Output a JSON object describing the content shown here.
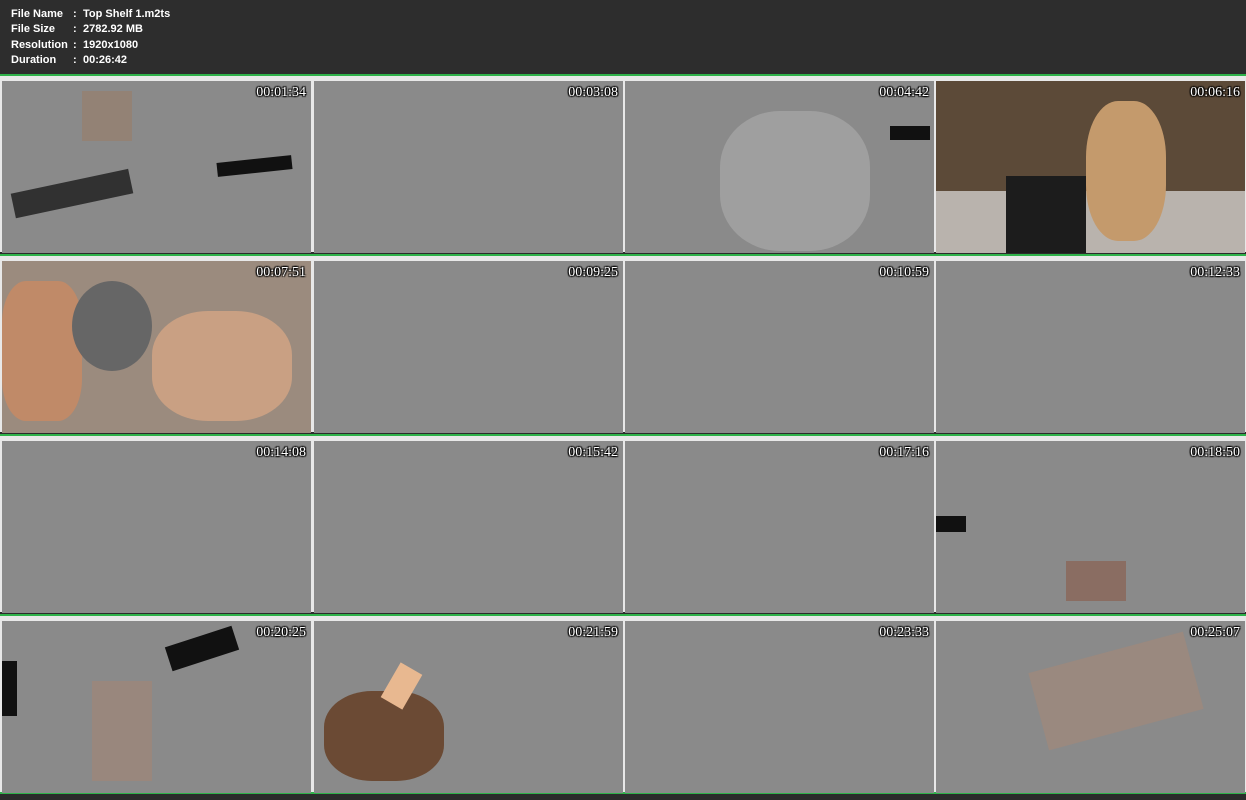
{
  "file_info": {
    "rows": [
      {
        "label": "File Name",
        "sep": ":",
        "value": "Top Shelf 1.m2ts"
      },
      {
        "label": "File Size",
        "sep": ":",
        "value": "2782.92 MB"
      },
      {
        "label": "Resolution",
        "sep": ":",
        "value": "1920x1080"
      },
      {
        "label": "Duration",
        "sep": ":",
        "value": "00:26:42"
      }
    ]
  },
  "thumbnails": [
    {
      "time": "00:01:34"
    },
    {
      "time": "00:03:08"
    },
    {
      "time": "00:04:42"
    },
    {
      "time": "00:06:16"
    },
    {
      "time": "00:07:51"
    },
    {
      "time": "00:09:25"
    },
    {
      "time": "00:10:59"
    },
    {
      "time": "00:12:33"
    },
    {
      "time": "00:14:08"
    },
    {
      "time": "00:15:42"
    },
    {
      "time": "00:17:16"
    },
    {
      "time": "00:18:50"
    },
    {
      "time": "00:20:25"
    },
    {
      "time": "00:21:59"
    },
    {
      "time": "00:23:33"
    },
    {
      "time": "00:25:07"
    }
  ],
  "colors": {
    "accent_border": "#2fb24a",
    "header_bg": "#2d2d2d",
    "thumb_gray": "#8a8a8a"
  }
}
